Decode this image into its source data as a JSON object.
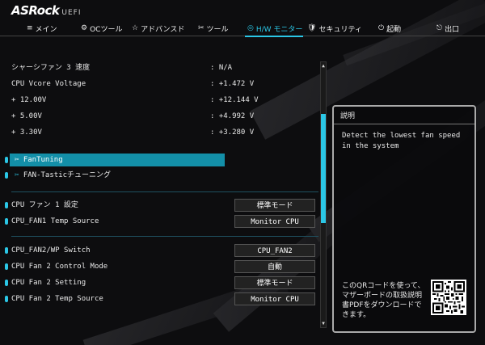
{
  "app": {
    "logo": "ASRock",
    "logo_suffix": "UEFI"
  },
  "nav": {
    "tabs": [
      {
        "icon": "≡",
        "label": "メイン"
      },
      {
        "icon": "⚙",
        "label": "OCツール"
      },
      {
        "icon": "☆",
        "label": "アドバンスド"
      },
      {
        "icon": "✂",
        "label": "ツール"
      },
      {
        "icon": "◎",
        "label": "H/W モニター"
      },
      {
        "icon": "🛡",
        "label": "セキュリティ"
      },
      {
        "icon": "⏻",
        "label": "起動"
      },
      {
        "icon": "⎋",
        "label": "出口"
      }
    ],
    "active_tab": "H/W モニター",
    "accent_color": "#2bc7e6"
  },
  "monitor": [
    {
      "label": "シャーシファン 3 速度",
      "value": ": N/A"
    },
    {
      "label": "CPU Vcore Voltage",
      "value": ": +1.472 V"
    },
    {
      "label": "+ 12.00V",
      "value": ": +12.144 V"
    },
    {
      "label": "+ 5.00V",
      "value": ": +4.992 V"
    },
    {
      "label": "+ 3.30V",
      "value": ": +3.280 V"
    }
  ],
  "links": [
    {
      "label": "FanTuning"
    },
    {
      "label": "FAN-Tasticチューニング"
    }
  ],
  "settings": [
    {
      "label": "CPU ファン 1 設定",
      "value": "標準モード"
    },
    {
      "label": "CPU_FAN1 Temp Source",
      "value": "Monitor CPU"
    },
    {
      "label": "CPU_FAN2/WP Switch",
      "value": "CPU_FAN2"
    },
    {
      "label": "CPU Fan 2 Control Mode",
      "value": "自動"
    },
    {
      "label": "CPU Fan 2 Setting",
      "value": "標準モード"
    },
    {
      "label": "CPU Fan 2 Temp Source",
      "value": "Monitor CPU"
    }
  ],
  "help": {
    "title": "説明",
    "description": "Detect the lowest fan speed in the system",
    "qr_text": "このQRコードを使って、マザーボードの取扱説明書PDFをダウンロードできます。"
  }
}
